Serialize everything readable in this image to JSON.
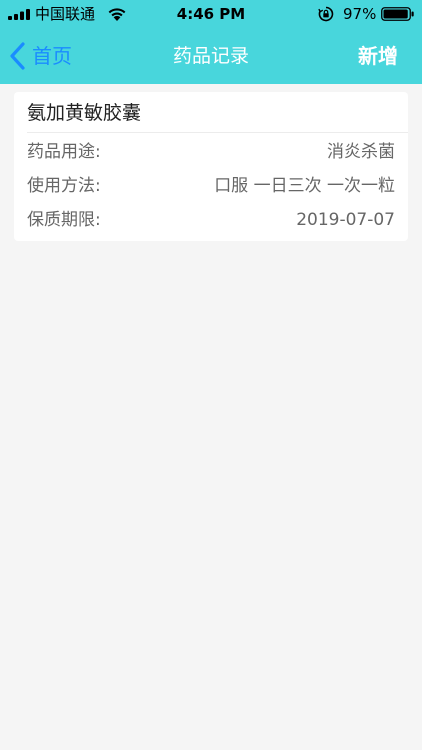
{
  "status_bar": {
    "carrier": "中国联通",
    "time": "4:46 PM",
    "battery_percent": "97%",
    "battery_level": 0.97
  },
  "nav": {
    "back_label": "首页",
    "title": "药品记录",
    "add_label": "新增"
  },
  "colors": {
    "header_bg": "#48d6dc",
    "back_blue": "#1a8cff",
    "page_bg": "#f5f5f5"
  },
  "records": [
    {
      "name": "氨加黄敏胶囊",
      "fields": [
        {
          "label": "药品用途:",
          "value": "消炎杀菌"
        },
        {
          "label": "使用方法:",
          "value": "口服 一日三次 一次一粒"
        },
        {
          "label": "保质期限:",
          "value": "2019-07-07"
        }
      ]
    }
  ]
}
